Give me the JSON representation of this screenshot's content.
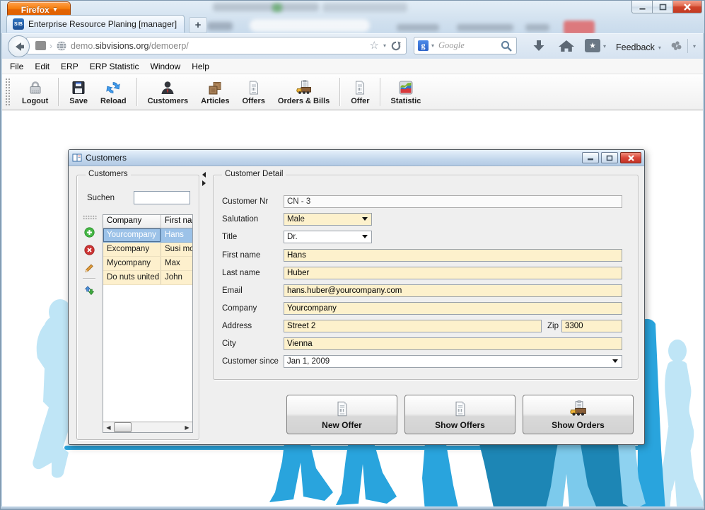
{
  "browser": {
    "menu_button": "Firefox",
    "menu_caret": "▾",
    "tab": {
      "favicon": "SIB",
      "title": "Enterprise Resource Planing [manager]",
      "new_tab": "+"
    },
    "url": {
      "prefix": "demo.",
      "domain": "sibvisions.org",
      "path": "/demoerp/"
    },
    "url_icons": {
      "star": "☆",
      "caret": "▾"
    },
    "search": {
      "placeholder": "Google",
      "caret": "▾"
    },
    "feedback": "Feedback",
    "feedback_caret": "▾",
    "overflow_caret": "▾"
  },
  "menubar": {
    "items": [
      "File",
      "Edit",
      "ERP",
      "ERP Statistic",
      "Window",
      "Help"
    ]
  },
  "toolbar": {
    "buttons": [
      {
        "label": "Logout",
        "icon": "lock-icon"
      },
      {
        "label": "Save",
        "icon": "floppy-icon"
      },
      {
        "label": "Reload",
        "icon": "reload-icon"
      },
      {
        "label": "Customers",
        "icon": "person-icon"
      },
      {
        "label": "Articles",
        "icon": "boxes-icon"
      },
      {
        "label": "Offers",
        "icon": "document-icon"
      },
      {
        "label": "Orders & Bills",
        "icon": "truck-icon"
      },
      {
        "label": "Offer",
        "icon": "document-icon"
      },
      {
        "label": "Statistic",
        "icon": "chart-icon"
      }
    ]
  },
  "app_window": {
    "title": "Customers",
    "left_panel": {
      "group_title": "Customers",
      "search_label": "Suchen",
      "search_value": "",
      "table": {
        "columns": [
          "Company",
          "First na"
        ],
        "rows": [
          {
            "company": "Yourcompany",
            "first_name": "Hans",
            "selected": true
          },
          {
            "company": "Excompany",
            "first_name": "Susi mo",
            "selected": false
          },
          {
            "company": "Mycompany",
            "first_name": "Max",
            "selected": false
          },
          {
            "company": "Do nuts united",
            "first_name": "John",
            "selected": false
          }
        ]
      }
    },
    "detail_panel": {
      "group_title": "Customer Detail",
      "fields": {
        "customer_nr": {
          "label": "Customer Nr",
          "value": "CN - 3"
        },
        "salutation": {
          "label": "Salutation",
          "value": "Male"
        },
        "title": {
          "label": "Title",
          "value": "Dr."
        },
        "first_name": {
          "label": "First name",
          "value": "Hans"
        },
        "last_name": {
          "label": "Last name",
          "value": "Huber"
        },
        "email": {
          "label": "Email",
          "value": "hans.huber@yourcompany.com"
        },
        "company": {
          "label": "Company",
          "value": "Yourcompany"
        },
        "address": {
          "label": "Address",
          "value": "Street 2"
        },
        "zip": {
          "label": "Zip",
          "value": "3300"
        },
        "city": {
          "label": "City",
          "value": "Vienna"
        },
        "customer_since": {
          "label": "Customer since",
          "value": "Jan 1, 2009"
        }
      },
      "buttons": [
        {
          "label": "New Offer",
          "icon": "document-icon"
        },
        {
          "label": "Show Offers",
          "icon": "document-icon"
        },
        {
          "label": "Show Orders",
          "icon": "truck-icon"
        }
      ]
    }
  },
  "colors": {
    "firefox_orange": "#e66000",
    "field_cream": "#fdf1cc",
    "selection_blue": "#9cc2e8",
    "silhouette_light": "#bfe5f6",
    "silhouette_medium": "#29a4dd",
    "silhouette_dark": "#1d86b5"
  }
}
